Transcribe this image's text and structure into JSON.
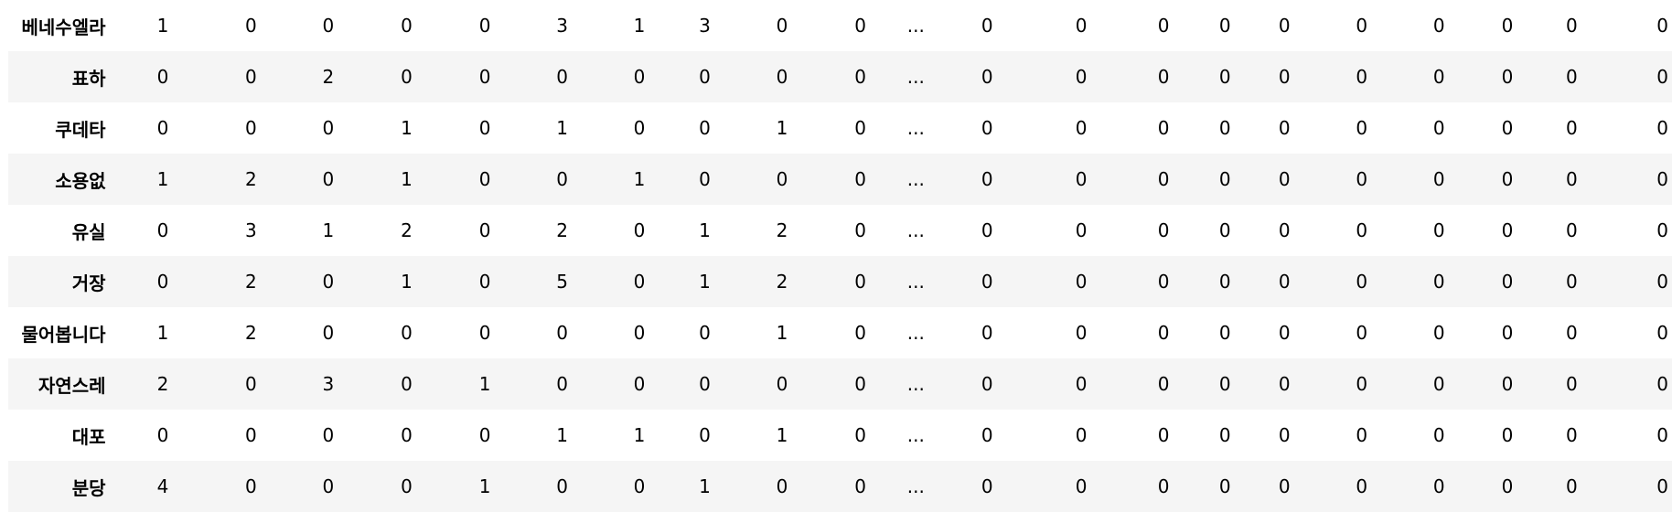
{
  "table": {
    "rows": [
      {
        "label": "베네수엘라",
        "values": [
          "1",
          "0",
          "0",
          "0",
          "0",
          "3",
          "1",
          "3",
          "0",
          "0",
          "...",
          "0",
          "0",
          "0",
          "0",
          "0",
          "0",
          "0",
          "0",
          "0",
          "0"
        ]
      },
      {
        "label": "표하",
        "values": [
          "0",
          "0",
          "2",
          "0",
          "0",
          "0",
          "0",
          "0",
          "0",
          "0",
          "...",
          "0",
          "0",
          "0",
          "0",
          "0",
          "0",
          "0",
          "0",
          "0",
          "0"
        ]
      },
      {
        "label": "쿠데타",
        "values": [
          "0",
          "0",
          "0",
          "1",
          "0",
          "1",
          "0",
          "0",
          "1",
          "0",
          "...",
          "0",
          "0",
          "0",
          "0",
          "0",
          "0",
          "0",
          "0",
          "0",
          "0"
        ]
      },
      {
        "label": "소용없",
        "values": [
          "1",
          "2",
          "0",
          "1",
          "0",
          "0",
          "1",
          "0",
          "0",
          "0",
          "...",
          "0",
          "0",
          "0",
          "0",
          "0",
          "0",
          "0",
          "0",
          "0",
          "0"
        ]
      },
      {
        "label": "유실",
        "values": [
          "0",
          "3",
          "1",
          "2",
          "0",
          "2",
          "0",
          "1",
          "2",
          "0",
          "...",
          "0",
          "0",
          "0",
          "0",
          "0",
          "0",
          "0",
          "0",
          "0",
          "0"
        ]
      },
      {
        "label": "거장",
        "values": [
          "0",
          "2",
          "0",
          "1",
          "0",
          "5",
          "0",
          "1",
          "2",
          "0",
          "...",
          "0",
          "0",
          "0",
          "0",
          "0",
          "0",
          "0",
          "0",
          "0",
          "0"
        ]
      },
      {
        "label": "물어봅니다",
        "values": [
          "1",
          "2",
          "0",
          "0",
          "0",
          "0",
          "0",
          "0",
          "1",
          "0",
          "...",
          "0",
          "0",
          "0",
          "0",
          "0",
          "0",
          "0",
          "0",
          "0",
          "0"
        ]
      },
      {
        "label": "자연스레",
        "values": [
          "2",
          "0",
          "3",
          "0",
          "1",
          "0",
          "0",
          "0",
          "0",
          "0",
          "...",
          "0",
          "0",
          "0",
          "0",
          "0",
          "0",
          "0",
          "0",
          "0",
          "0"
        ]
      },
      {
        "label": "대포",
        "values": [
          "0",
          "0",
          "0",
          "0",
          "0",
          "1",
          "1",
          "0",
          "1",
          "0",
          "...",
          "0",
          "0",
          "0",
          "0",
          "0",
          "0",
          "0",
          "0",
          "0",
          "0"
        ]
      },
      {
        "label": "분당",
        "values": [
          "4",
          "0",
          "0",
          "0",
          "1",
          "0",
          "0",
          "1",
          "0",
          "0",
          "...",
          "0",
          "0",
          "0",
          "0",
          "0",
          "0",
          "0",
          "0",
          "0",
          "0"
        ]
      }
    ]
  },
  "colors": {
    "row_stripe": "#f5f5f5",
    "selection_strip": "#e3f1fb"
  }
}
